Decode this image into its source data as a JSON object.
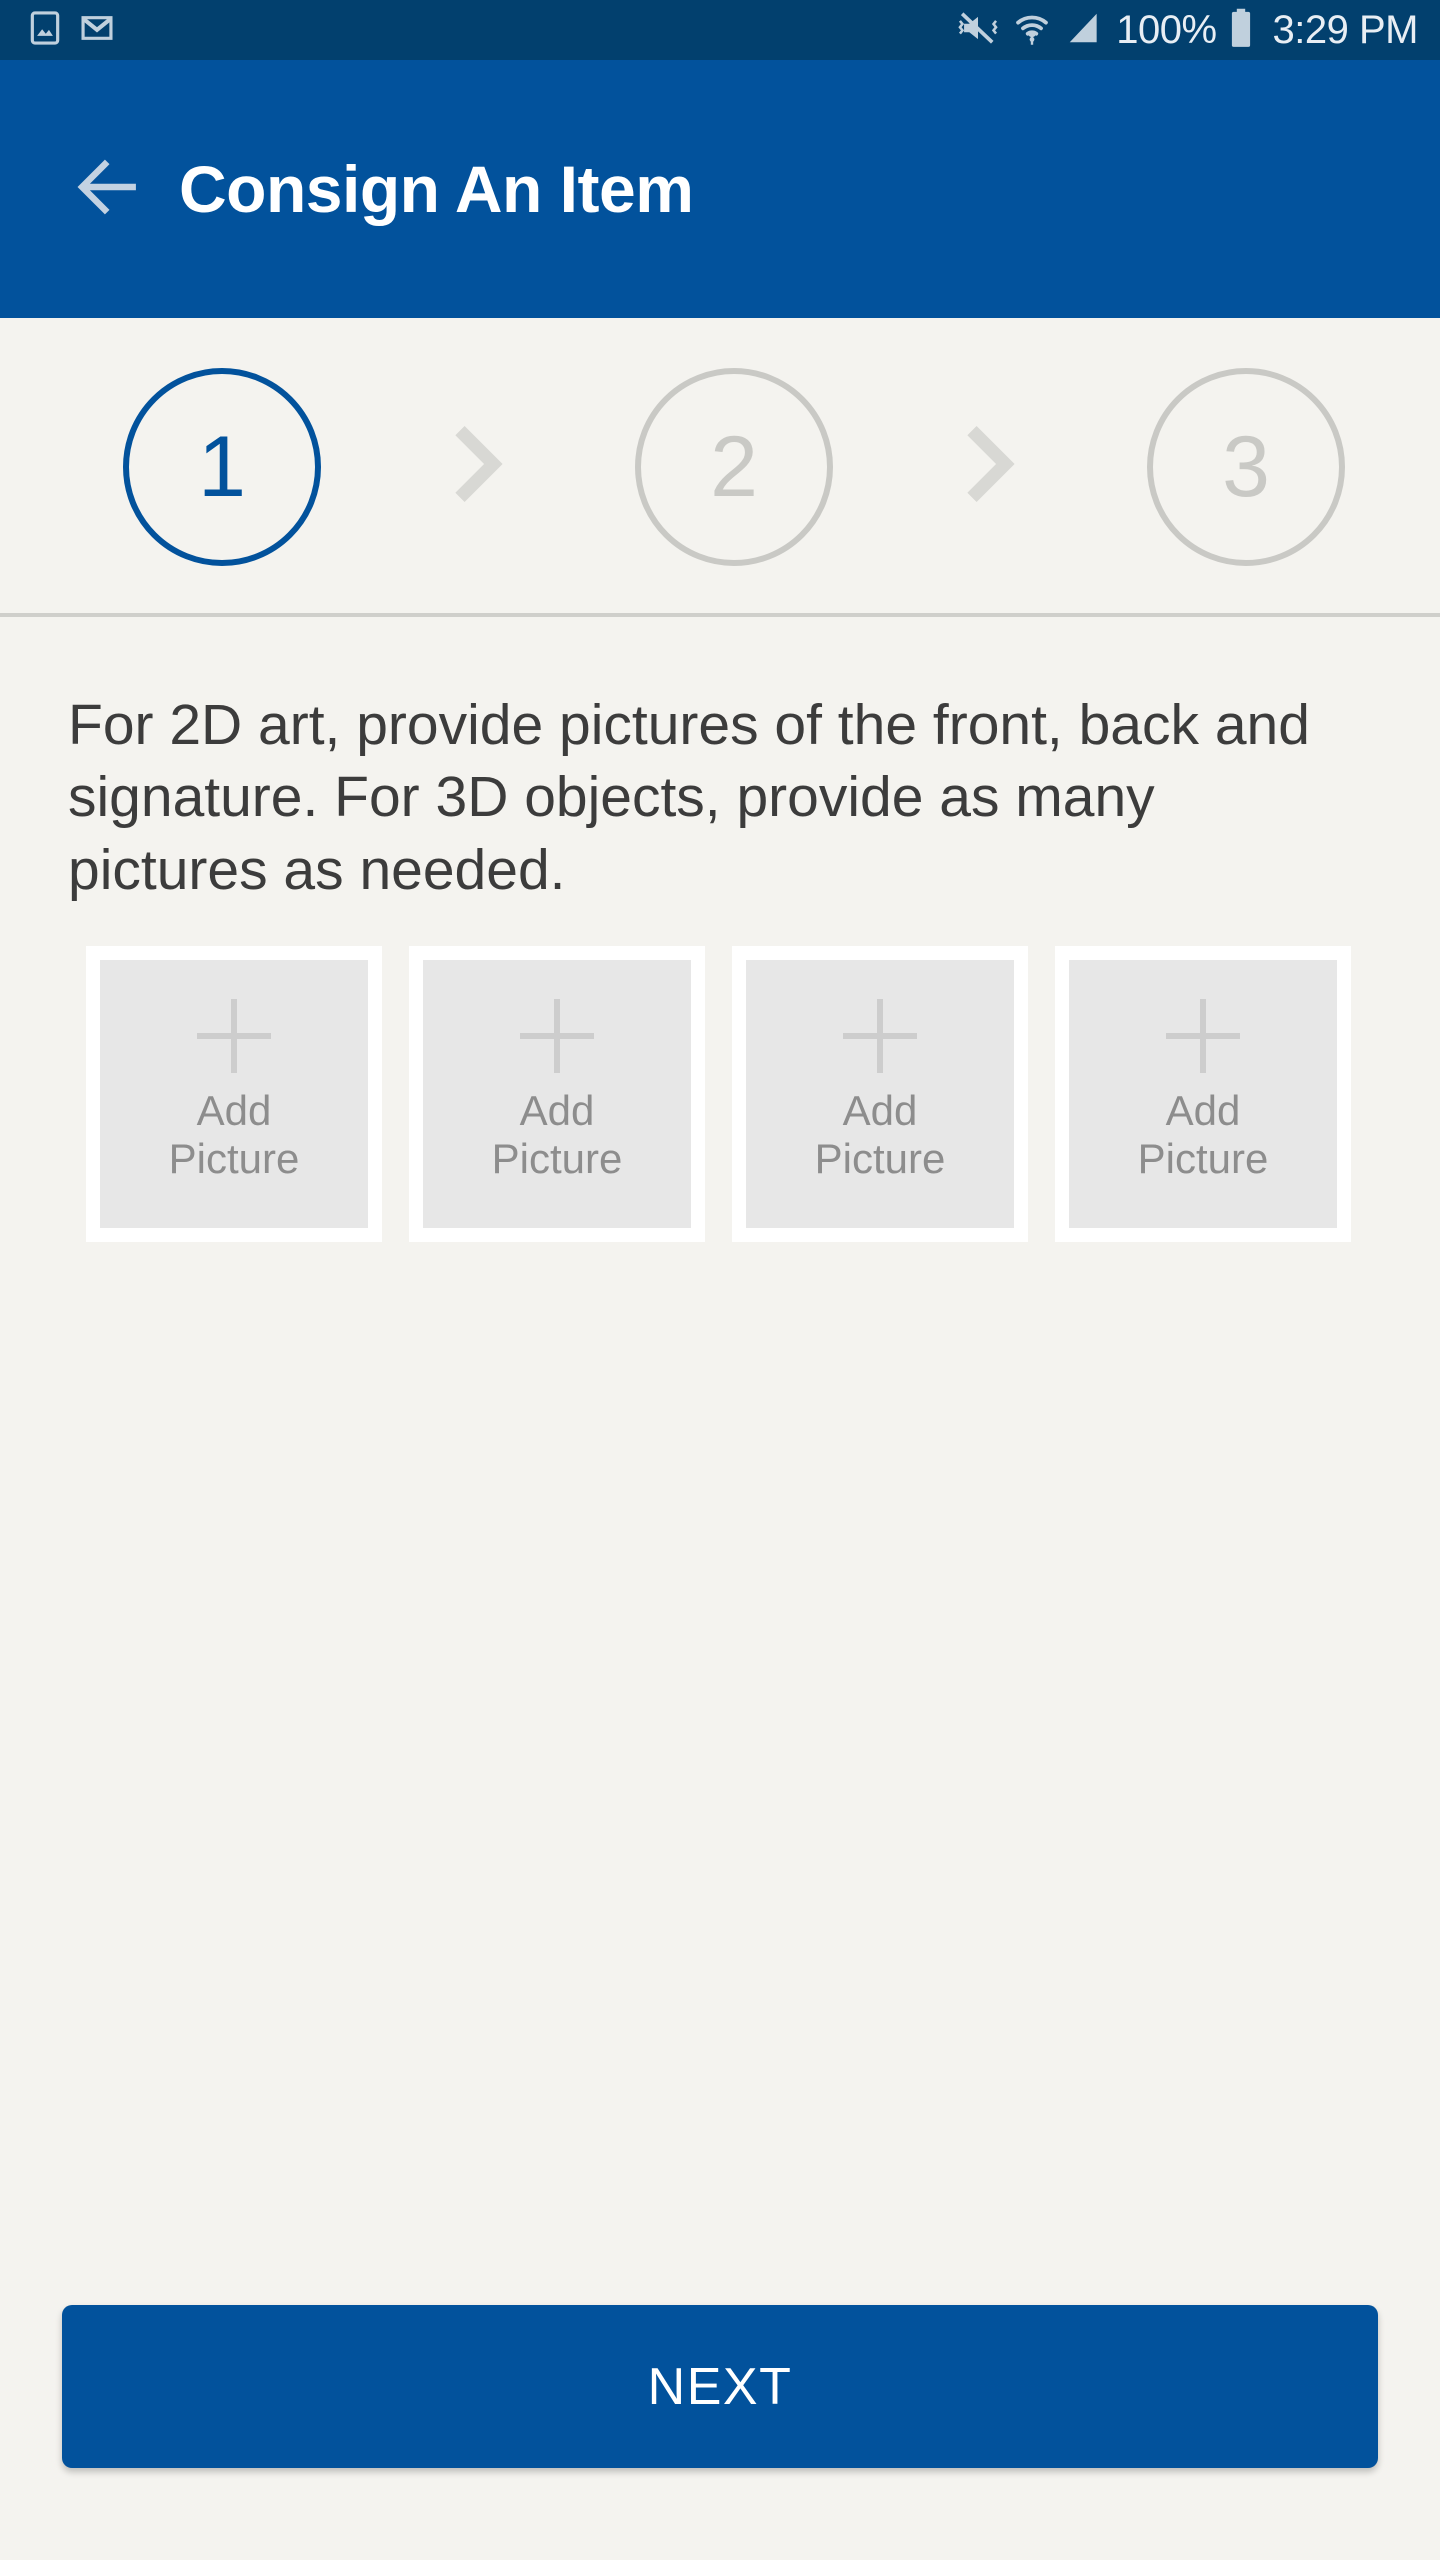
{
  "status_bar": {
    "left_icons": [
      "gallery-icon",
      "gmail-icon"
    ],
    "right_icons": [
      "mute-vibrate-icon",
      "wifi-icon",
      "cellular-signal-icon",
      "battery-icon"
    ],
    "battery_percent": "100%",
    "clock": "3:29 PM",
    "background_color": "#02406e"
  },
  "app_bar": {
    "back_icon": "arrow-left-icon",
    "title": "Consign An Item",
    "background_color": "#02529c"
  },
  "stepper": {
    "steps": [
      {
        "label": "1",
        "active": true
      },
      {
        "label": "2",
        "active": false
      },
      {
        "label": "3",
        "active": false
      }
    ],
    "separator_icon": "chevron-right-icon",
    "active_color": "#02529c",
    "inactive_color": "#c9c9c5"
  },
  "main": {
    "instruction": "For 2D art, provide pictures of the front, back and signature. For 3D objects, provide as many pictures as needed.",
    "tiles": [
      {
        "label": "Add\nPicture",
        "icon": "plus-icon"
      },
      {
        "label": "Add\nPicture",
        "icon": "plus-icon"
      },
      {
        "label": "Add\nPicture",
        "icon": "plus-icon"
      },
      {
        "label": "Add\nPicture",
        "icon": "plus-icon"
      }
    ]
  },
  "footer": {
    "next_label": "NEXT",
    "next_color": "#02529c"
  },
  "page_background": "#f4f3ef"
}
